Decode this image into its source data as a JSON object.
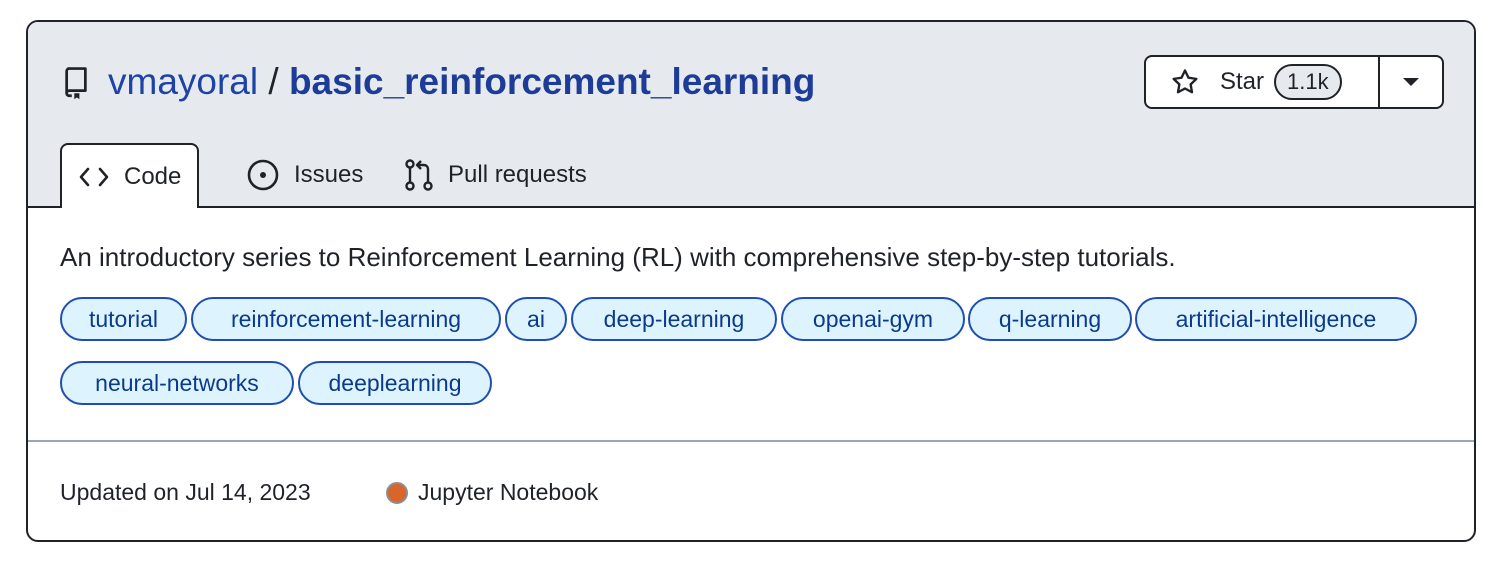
{
  "repo": {
    "owner": "vmayoral",
    "separator": "/",
    "name": "basic_reinforcement_learning"
  },
  "star": {
    "label": "Star",
    "count": "1.1k"
  },
  "tabs": [
    {
      "label": "Code",
      "icon": "code-icon",
      "active": true
    },
    {
      "label": "Issues",
      "icon": "issue-opened-icon",
      "active": false
    },
    {
      "label": "Pull requests",
      "icon": "git-pull-request-icon",
      "active": false
    }
  ],
  "description": "An introductory series to Reinforcement Learning (RL) with comprehensive step-by-step tutorials.",
  "topics": [
    "tutorial",
    "reinforcement-learning",
    "ai",
    "deep-learning",
    "openai-gym",
    "q-learning",
    "artificial-intelligence",
    "neural-networks",
    "deeplearning"
  ],
  "footer": {
    "updated": "Updated on Jul 14, 2023",
    "language": "Jupyter Notebook",
    "language_color": "#DA5B0B"
  },
  "colors": {
    "link": "#1e43a6",
    "topic_bg": "#ddf4ff",
    "topic_border": "#1e4fb0",
    "header_bg": "#e6eaef"
  }
}
